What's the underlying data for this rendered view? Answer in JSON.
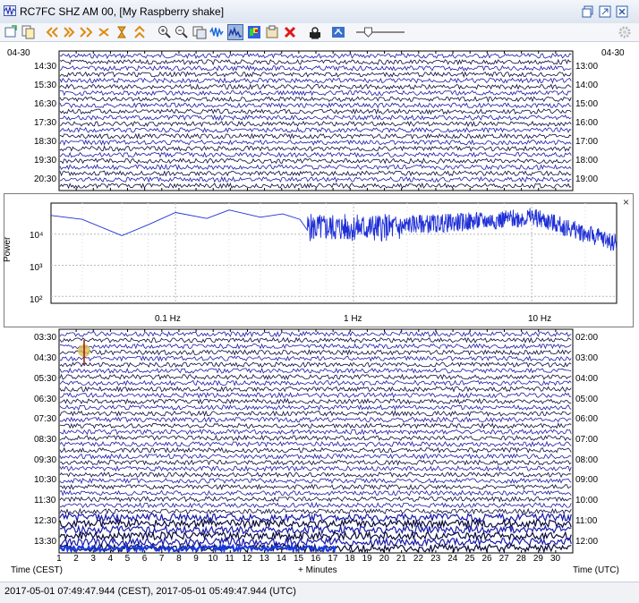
{
  "window": {
    "title": "RC7FC SHZ AM 00, [My Raspberry shake]"
  },
  "toolbar": {
    "icons": [
      "new-window-icon",
      "copy-icon",
      "first-icon",
      "prev-icon",
      "next-icon",
      "last-icon",
      "expand-icon",
      "compress-icon",
      "zoom-in-icon",
      "zoom-out-icon",
      "copy-image-icon",
      "filter-icon",
      "spectrum-icon",
      "spectrogram-icon",
      "export-icon",
      "clear-icon",
      "seismometer-icon",
      "connect-icon",
      "gain-slider-icon"
    ],
    "gain_level": 0.25
  },
  "helicorder_top": {
    "date_left": "04-30",
    "date_right": "04-30",
    "left_times": [
      "14:30",
      "15:30",
      "16:30",
      "17:30",
      "18:30",
      "19:30",
      "20:30"
    ],
    "right_times": [
      "13:00",
      "14:00",
      "15:00",
      "16:00",
      "17:00",
      "18:00",
      "19:00"
    ]
  },
  "spectrum": {
    "ylabel": "Power",
    "y_ticks": [
      "10⁴",
      "10³",
      "10²"
    ],
    "x_ticks": [
      "0.1 Hz",
      "1 Hz",
      "10 Hz"
    ],
    "close_label": "×"
  },
  "helicorder_bottom": {
    "left_times": [
      "03:30",
      "04:30",
      "05:30",
      "06:30",
      "07:30",
      "08:30",
      "09:30",
      "10:30",
      "11:30",
      "12:30",
      "13:30"
    ],
    "right_times": [
      "02:00",
      "03:00",
      "04:00",
      "05:00",
      "06:00",
      "07:00",
      "08:00",
      "09:00",
      "10:00",
      "11:00",
      "12:00"
    ],
    "x_ticks": [
      "1",
      "2",
      "3",
      "4",
      "5",
      "6",
      "7",
      "8",
      "9",
      "10",
      "11",
      "12",
      "13",
      "14",
      "15",
      "16",
      "17",
      "18",
      "19",
      "20",
      "21",
      "22",
      "23",
      "24",
      "25",
      "26",
      "27",
      "28",
      "29",
      "30"
    ],
    "left_axis_label": "Time (CEST)",
    "center_axis_label": "+ Minutes",
    "right_axis_label": "Time (UTC)"
  },
  "status_bar": {
    "text": "2017-05-01 07:49:47.944 (CEST), 2017-05-01 05:49:47.944 (UTC)"
  },
  "colors": {
    "trace_blue": "#1a1aa8",
    "trace_dark": "#0a0a3a",
    "psd_line": "#1f2fd6",
    "grid": "#b8b8b8"
  }
}
